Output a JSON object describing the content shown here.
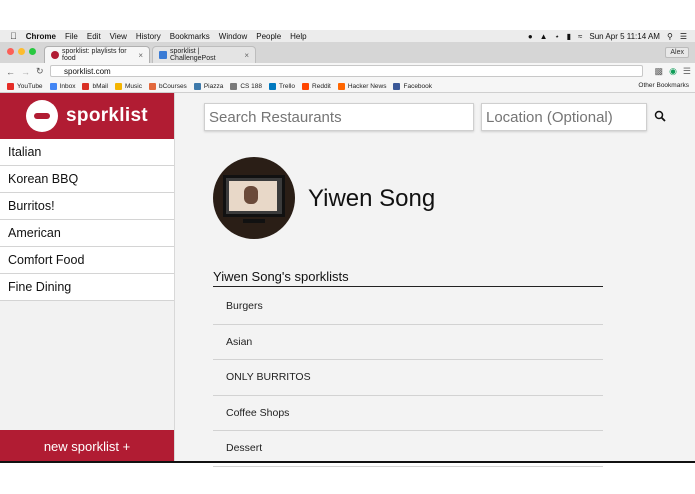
{
  "menubar": {
    "app": "Chrome",
    "items": [
      "File",
      "Edit",
      "View",
      "History",
      "Bookmarks",
      "Window",
      "People",
      "Help"
    ],
    "clock": "Sun Apr 5  11:14 AM",
    "user": "Alex"
  },
  "tabs": [
    {
      "label": "sporklist: playlists for food",
      "color": "#b11c33"
    },
    {
      "label": "sporklist | ChallengePost",
      "color": "#3a7bd5"
    }
  ],
  "address": {
    "url": "sporklist.com"
  },
  "bookmarks": [
    {
      "label": "YouTube",
      "color": "#e52d27"
    },
    {
      "label": "Inbox",
      "color": "#4285f4"
    },
    {
      "label": "bMail",
      "color": "#d93025"
    },
    {
      "label": "Music",
      "color": "#f4b400"
    },
    {
      "label": "bCourses",
      "color": "#e2683c"
    },
    {
      "label": "Piazza",
      "color": "#3e7aab"
    },
    {
      "label": "CS 188",
      "color": "#7a7a7a"
    },
    {
      "label": "Trello",
      "color": "#0079bf"
    },
    {
      "label": "Reddit",
      "color": "#ff4500"
    },
    {
      "label": "Hacker News",
      "color": "#ff6600"
    },
    {
      "label": "Facebook",
      "color": "#3b5998"
    }
  ],
  "other_bookmarks": "Other Bookmarks",
  "brand": {
    "name": "sporklist",
    "color": "#b11c33"
  },
  "categories": [
    "Italian",
    "Korean BBQ",
    "Burritos!",
    "American",
    "Comfort Food",
    "Fine Dining"
  ],
  "new_button": "new sporklist +",
  "search": {
    "placeholder": "Search Restaurants"
  },
  "location": {
    "placeholder": "Location (Optional)"
  },
  "profile": {
    "name": "Yiwen Song",
    "lists_title": "Yiwen Song's sporklists"
  },
  "sporklists": [
    "Burgers",
    "Asian",
    "ONLY BURRITOS",
    "Coffee Shops",
    "Dessert"
  ]
}
